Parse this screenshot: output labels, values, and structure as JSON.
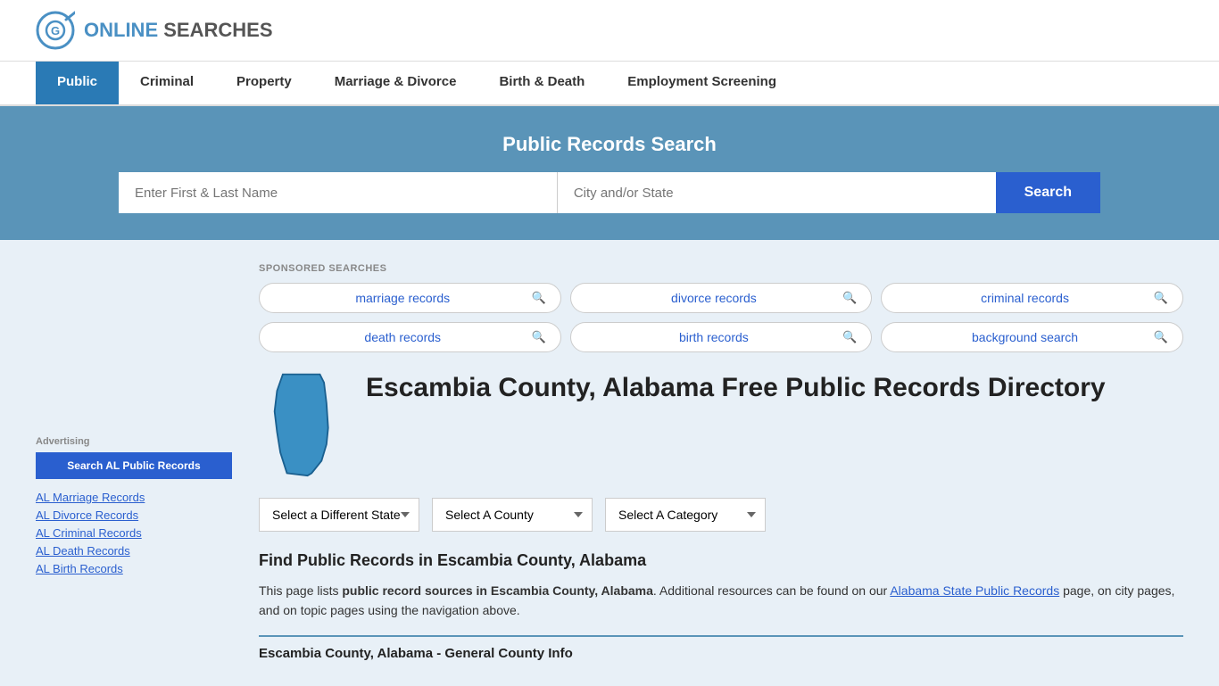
{
  "header": {
    "logo_online": "ONLINE",
    "logo_searches": "SEARCHES"
  },
  "nav": {
    "items": [
      {
        "label": "Public",
        "active": true
      },
      {
        "label": "Criminal",
        "active": false
      },
      {
        "label": "Property",
        "active": false
      },
      {
        "label": "Marriage & Divorce",
        "active": false
      },
      {
        "label": "Birth & Death",
        "active": false
      },
      {
        "label": "Employment Screening",
        "active": false
      }
    ]
  },
  "search_banner": {
    "title": "Public Records Search",
    "name_placeholder": "Enter First & Last Name",
    "location_placeholder": "City and/or State",
    "button_label": "Search"
  },
  "sponsored": {
    "label": "SPONSORED SEARCHES",
    "tags": [
      {
        "text": "marriage records"
      },
      {
        "text": "divorce records"
      },
      {
        "text": "criminal records"
      },
      {
        "text": "death records"
      },
      {
        "text": "birth records"
      },
      {
        "text": "background search"
      }
    ]
  },
  "county": {
    "title": "Escambia County, Alabama Free Public Records Directory"
  },
  "dropdowns": {
    "state_label": "Select a Different State",
    "county_label": "Select A County",
    "category_label": "Select A Category"
  },
  "find": {
    "title": "Find Public Records in Escambia County, Alabama",
    "text_part1": "This page lists ",
    "text_bold": "public record sources in Escambia County, Alabama",
    "text_part2": ". Additional resources can be found on our ",
    "link_text": "Alabama State Public Records",
    "text_part3": " page, on city pages, and on topic pages using the navigation above."
  },
  "section_bottom": {
    "label": "Escambia County, Alabama - General County Info"
  },
  "sidebar": {
    "ad_label": "Advertising",
    "ad_button": "Search AL Public Records",
    "links": [
      {
        "text": "AL Marriage Records"
      },
      {
        "text": "AL Divorce Records"
      },
      {
        "text": "AL Criminal Records"
      },
      {
        "text": "AL Death Records"
      },
      {
        "text": "AL Birth Records"
      }
    ]
  }
}
